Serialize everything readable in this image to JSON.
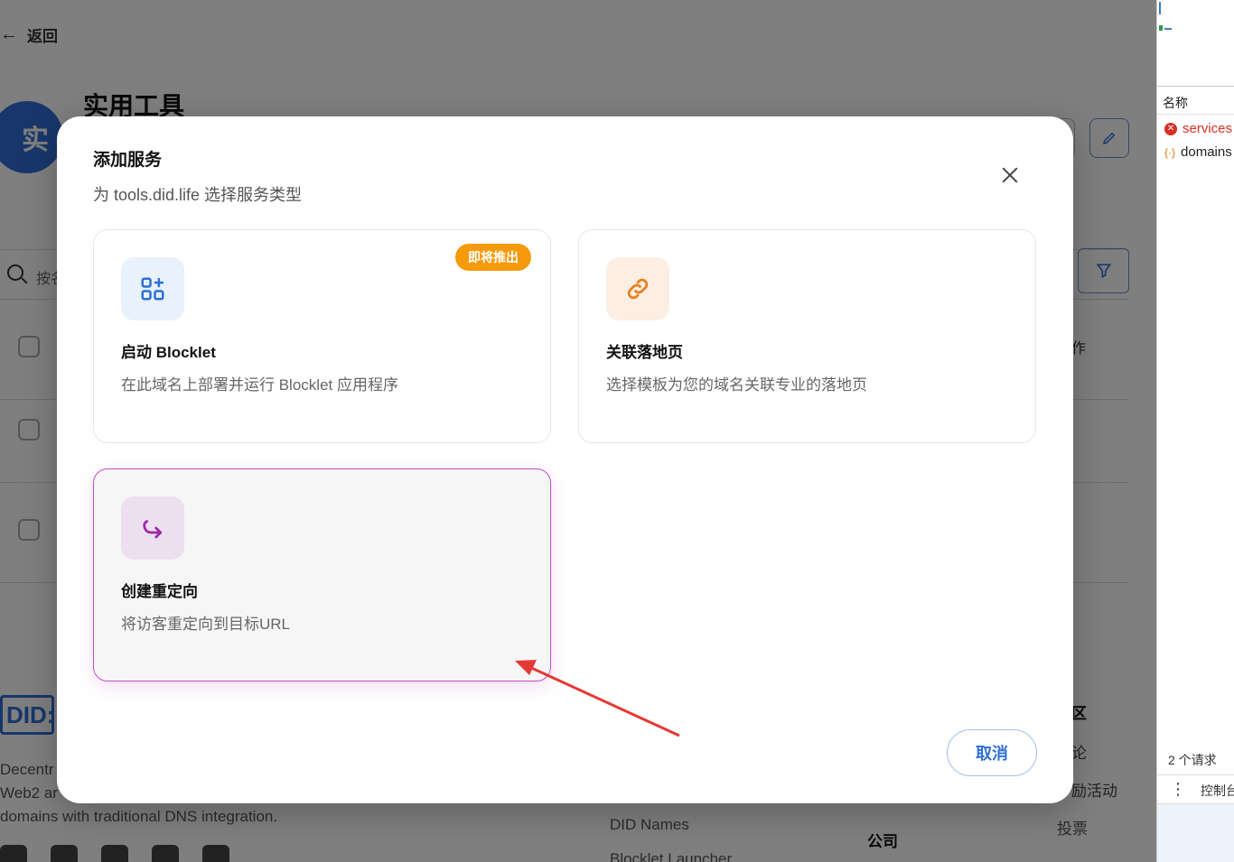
{
  "page": {
    "back_label": "返回",
    "avatar_letter": "实",
    "title": "实用工具",
    "search_placeholder": "按名",
    "column_op": "作",
    "logo_text": "DID:",
    "footer_line1": "Decentr",
    "footer_line2": "Web2 ar",
    "footer_line3": "domains with traditional DNS integration.",
    "footer_community_head": "区",
    "footer_community_1": "论",
    "footer_community_2": "励活动",
    "footer_links_1": "DID Names",
    "footer_links_2": "Blocklet Launcher",
    "footer_company": "公司",
    "footer_vote": "投票"
  },
  "dialog": {
    "title": "添加服务",
    "subtitle": "为 tools.did.life 选择服务类型",
    "cards": [
      {
        "title": "启动 Blocklet",
        "desc": "在此域名上部署并运行 Blocklet 应用程序",
        "badge": "即将推出",
        "icon": "apps-add-icon"
      },
      {
        "title": "关联落地页",
        "desc": "选择模板为您的域名关联专业的落地页",
        "icon": "link-icon"
      },
      {
        "title": "创建重定向",
        "desc": "将访客重定向到目标URL",
        "icon": "redirect-arrow-icon"
      }
    ],
    "cancel_label": "取消"
  },
  "devtools": {
    "header": "名称",
    "items": [
      "services",
      "domains"
    ],
    "request_count": "2 个请求",
    "console_label": "控制台"
  },
  "colors": {
    "primary": "#2e6fd6",
    "badge": "#f59a0b",
    "selected_border": "#c050c8",
    "annotation": "#e53935"
  }
}
